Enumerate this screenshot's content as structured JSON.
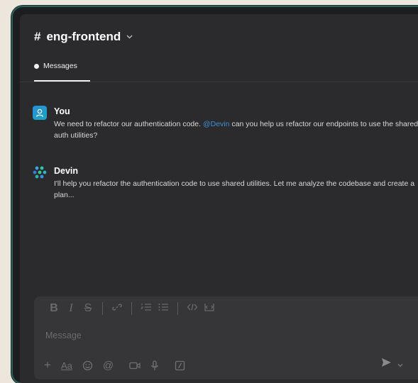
{
  "channel": {
    "hash": "#",
    "name": "eng-frontend"
  },
  "tabs": [
    {
      "label": "Messages"
    }
  ],
  "messages": [
    {
      "author": "You",
      "text_before": "We need to refactor our authentication code. ",
      "mention": "@Devin",
      "text_after": " can you help us refactor our endpoints to use the shared auth utilities?"
    },
    {
      "author": "Devin",
      "text": "I'll help you refactor the authentication code to use shared utilities. Let me analyze the codebase and create a plan..."
    }
  ],
  "composer": {
    "placeholder": "Message",
    "format_tools": [
      "bold-icon",
      "italic-icon",
      "strikethrough-icon",
      "link-icon",
      "ordered-list-icon",
      "bullet-list-icon",
      "code-icon",
      "code-block-icon"
    ],
    "bottom_tools": [
      "plus-icon",
      "text-format-icon",
      "emoji-icon",
      "mention-icon",
      "video-icon",
      "microphone-icon",
      "slash-command-icon"
    ],
    "text_format_label": "Aa"
  },
  "colors": {
    "accent_teal": "#2e5e57",
    "mention": "#3f8fd6",
    "background": "#ede6dc"
  }
}
